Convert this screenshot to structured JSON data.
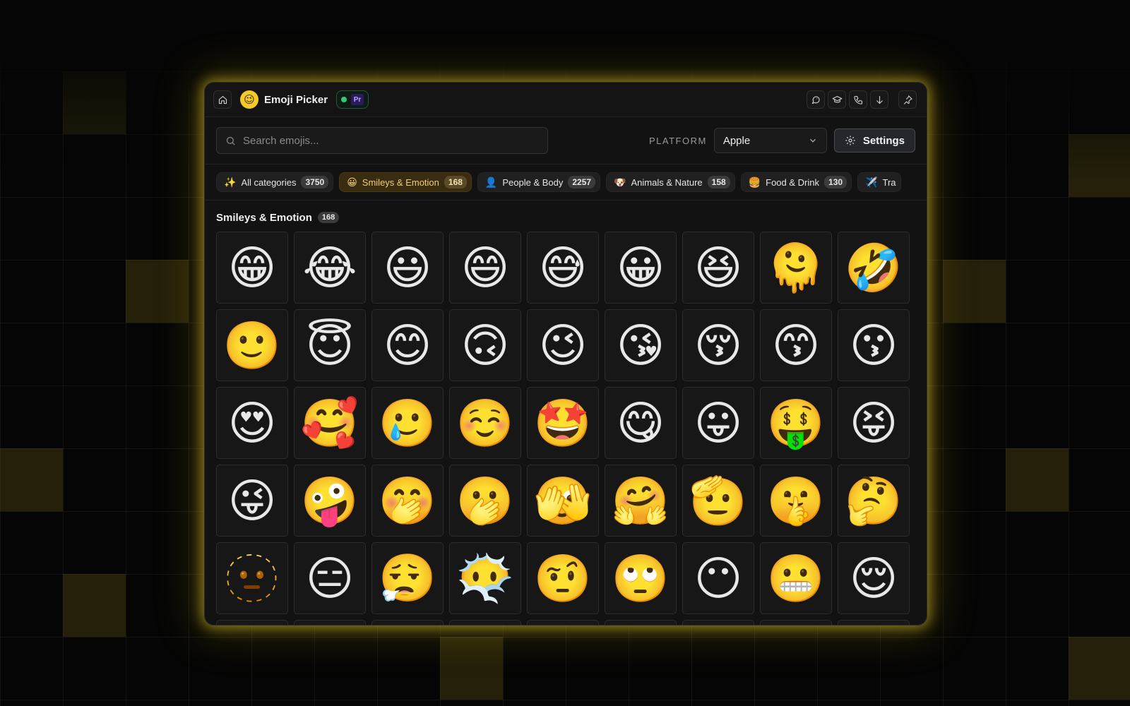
{
  "titlebar": {
    "app_title": "Emoji Picker",
    "logo_glyph": "😉",
    "badge_text": "Pr",
    "home_icon": "home-icon",
    "right_icons": [
      "chat-icon",
      "graduation-cap-icon",
      "phone-icon",
      "arrow-down-icon"
    ],
    "pin_icon": "pin-icon"
  },
  "toolbar": {
    "search_placeholder": "Search emojis...",
    "platform_label": "PLATFORM",
    "platform_value": "Apple",
    "settings_label": "Settings"
  },
  "categories": [
    {
      "emoji": "✨",
      "label": "All categories",
      "count": "3750",
      "active": false
    },
    {
      "emoji": "😀",
      "label": "Smileys & Emotion",
      "count": "168",
      "active": true
    },
    {
      "emoji": "👤",
      "label": "People & Body",
      "count": "2257",
      "active": false
    },
    {
      "emoji": "🐶",
      "label": "Animals & Nature",
      "count": "158",
      "active": false
    },
    {
      "emoji": "🍔",
      "label": "Food & Drink",
      "count": "130",
      "active": false
    },
    {
      "emoji": "✈️",
      "label": "Tra",
      "count": "",
      "active": false
    }
  ],
  "section": {
    "title": "Smileys & Emotion",
    "count": "168"
  },
  "emojis": [
    "😁",
    "😂",
    "😃",
    "😄",
    "😅",
    "😀",
    "😆",
    "🫠",
    "🤣",
    "🙂",
    "😇",
    "😊",
    "🙃",
    "😉",
    "😘",
    "😚",
    "😙",
    "😗",
    "😍",
    "🥰",
    "🥲",
    "☺️",
    "🤩",
    "😋",
    "😛",
    "🤑",
    "😝",
    "😜",
    "🤪",
    "🤭",
    "🫢",
    "🫣",
    "🤗",
    "🫡",
    "🤫",
    "🤔",
    "🫥",
    "😑",
    "😮‍💨",
    "😶‍🌫️",
    "🤨",
    "🙄",
    "😶",
    "😬",
    "😌"
  ],
  "colors": {
    "accent_glow": "#e6c828",
    "active_chip_bg": "#3a2c10",
    "status_dot": "#2ecc71"
  }
}
